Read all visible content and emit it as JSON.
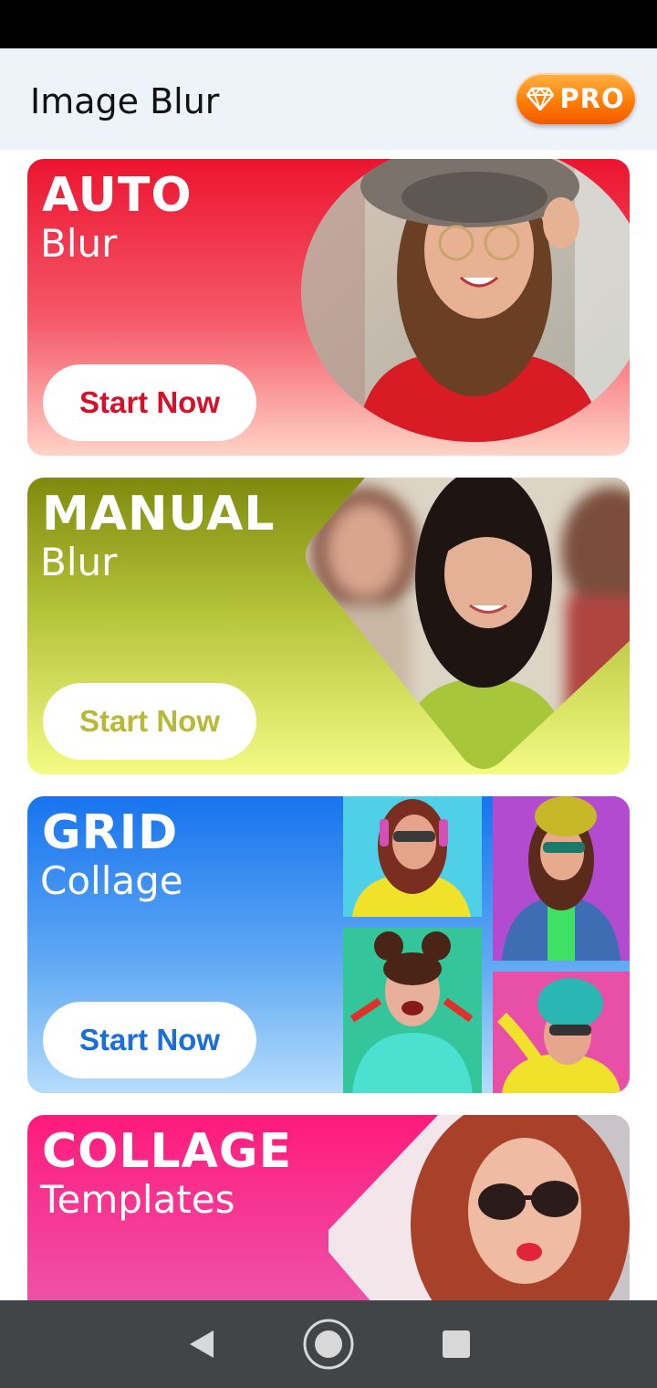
{
  "app": {
    "title": "Image Blur"
  },
  "header": {
    "pro_label": "PRO",
    "pro_icon": "diamond-icon"
  },
  "cards": [
    {
      "title": "AUTO",
      "subtitle": "Blur",
      "button": "Start Now"
    },
    {
      "title": "MANUAL",
      "subtitle": "Blur",
      "button": "Start Now"
    },
    {
      "title": "GRID",
      "subtitle": "Collage",
      "button": "Start Now"
    },
    {
      "title": "COLLAGE",
      "subtitle": "Templates"
    }
  ],
  "nav": {
    "back": "back-icon",
    "home": "home-icon",
    "recents": "recents-icon"
  },
  "colors": {
    "auto": "#ec1430",
    "manual": "#9aa41f",
    "grid": "#1774ee",
    "collage": "#ff1a7c",
    "pro": "#ff7a00"
  }
}
